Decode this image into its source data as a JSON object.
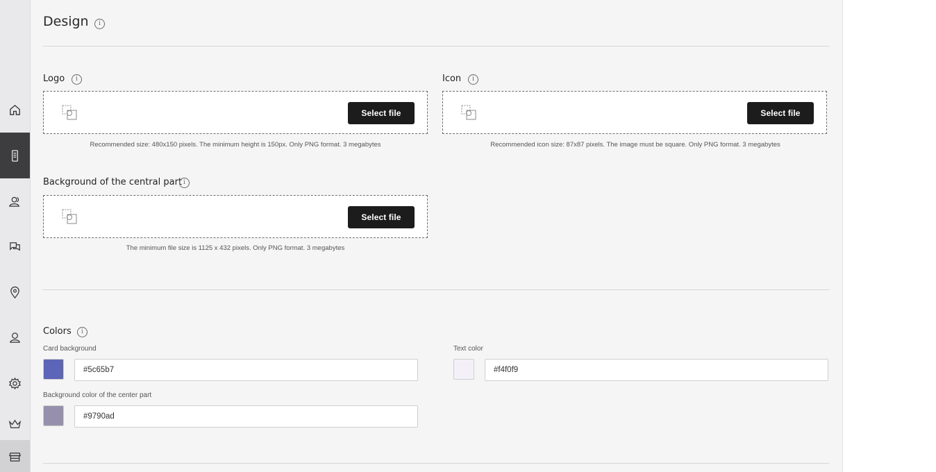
{
  "page": {
    "title": "Design"
  },
  "sidebar": {
    "items": [
      {
        "icon": "home-icon"
      },
      {
        "icon": "device-icon",
        "active": true
      },
      {
        "icon": "users-icon"
      },
      {
        "icon": "chat-icon"
      },
      {
        "icon": "location-pin-icon"
      },
      {
        "icon": "profile-icon"
      },
      {
        "icon": "gear-icon"
      },
      {
        "icon": "crown-icon"
      },
      {
        "icon": "store-icon"
      }
    ]
  },
  "logo": {
    "label": "Logo",
    "button": "Select file",
    "hint": "Recommended size: 480x150 pixels. The minimum height is 150px. Only PNG format. 3 megabytes"
  },
  "icon_upload": {
    "label": "Icon",
    "button": "Select file",
    "hint": "Recommended icon size: 87x87 pixels. The image must be square. Only PNG format. 3 megabytes"
  },
  "background": {
    "label": "Background of the central part",
    "button": "Select file",
    "hint": "The minimum file size is 1125 x 432 pixels. Only PNG format. 3 megabytes"
  },
  "colors": {
    "label": "Colors",
    "card_background": {
      "label": "Card background",
      "value": "#5c65b7",
      "color": "#5c65b7"
    },
    "text_color": {
      "label": "Text color",
      "value": "#f4f0f9",
      "color": "#f4f0f9"
    },
    "center_background": {
      "label": "Background color of the center part",
      "value": "#9790ad",
      "color": "#9790ad"
    }
  }
}
